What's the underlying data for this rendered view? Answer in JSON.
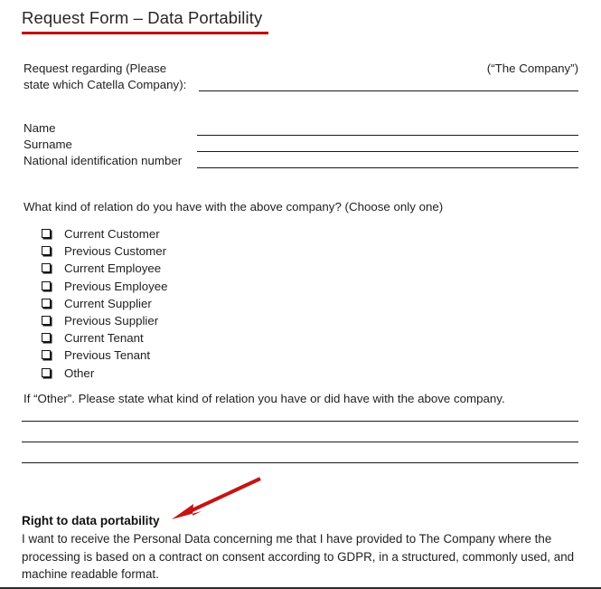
{
  "document": {
    "title": "Request Form – Data Portability",
    "accent_color": "#c00000",
    "text_color": "#1f1f1f"
  },
  "company_section": {
    "label_line_1": "Request regarding (Please",
    "label_line_2": "state which Catella Company):",
    "note": "(“The Company”)",
    "input_value": "",
    "input_placeholder": ""
  },
  "identity_section": {
    "fields": [
      {
        "label": "Name",
        "value": "",
        "placeholder": ""
      },
      {
        "label": "Surname",
        "value": "",
        "placeholder": ""
      },
      {
        "label": "National identification number",
        "value": "",
        "placeholder": ""
      }
    ]
  },
  "relation_section": {
    "question": "What kind of relation do you have with the above company? (Choose only one)",
    "options": [
      {
        "label": "Current Customer",
        "checked": false
      },
      {
        "label": "Previous Customer",
        "checked": false
      },
      {
        "label": "Current Employee",
        "checked": false
      },
      {
        "label": "Previous Employee",
        "checked": false
      },
      {
        "label": "Current Supplier",
        "checked": false
      },
      {
        "label": "Previous Supplier",
        "checked": false
      },
      {
        "label": "Current Tenant",
        "checked": false
      },
      {
        "label": "Previous Tenant",
        "checked": false
      },
      {
        "label": "Other",
        "checked": false
      }
    ]
  },
  "other_section": {
    "prompt": "If “Other”. Please state what kind of relation you have or did have with the above company.",
    "line_values": [
      "",
      "",
      ""
    ]
  },
  "annotation": {
    "type": "arrow",
    "color": "#c51414",
    "points_to": "Right to data portability"
  },
  "portability_section": {
    "heading": "Right to data portability",
    "body": "I want to receive the Personal Data concerning me that I have provided to The Company where the processing is based on a contract on consent according to GDPR, in a structured, commonly used, and machine readable format."
  }
}
